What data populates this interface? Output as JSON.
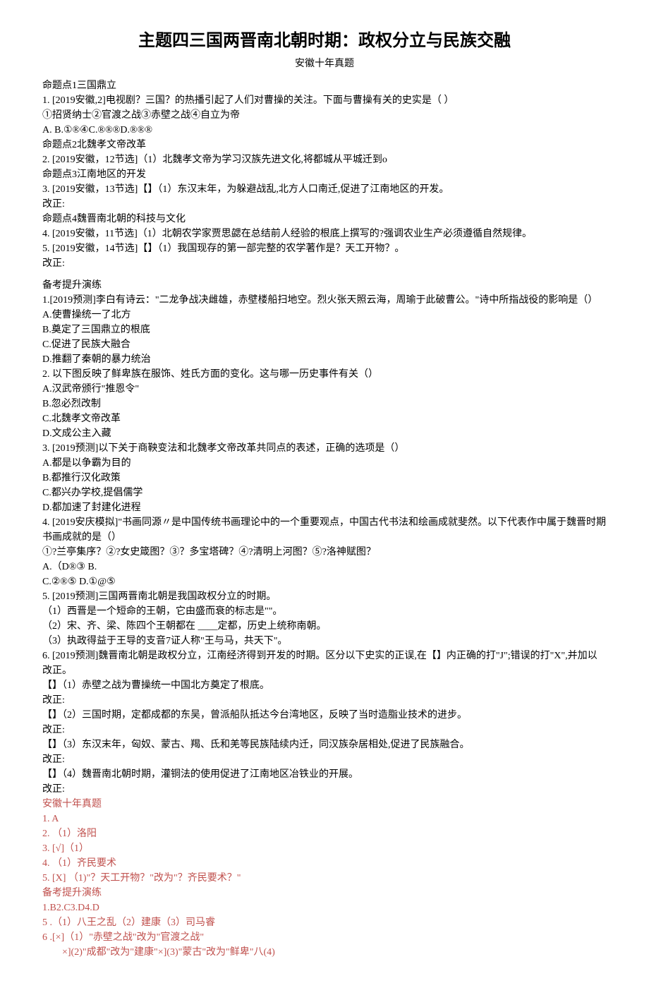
{
  "title": "主题四三国两晋南北朝时期：政权分立与民族交融",
  "subtitle": "安徽十年真题",
  "section1": {
    "cmd1": "命题点1三国鼎立",
    "q1l1": "1. [2019安徽,2]电视剧？三国？的热播引起了人们对曹操的关注。下面与曹操有关的史实是（   ）",
    "q1l2": "①招贤纳士②官渡之战③赤壁之战④自立为帝",
    "q1l3": "A.        B.①®④C.®®®D.®®®",
    "cmd2": "命题点2北魏孝文帝改革",
    "q2": "2. [2019安徽，12节选]（1）北魏孝文帝为学习汉族先进文化,将都城从平城迁到o",
    "cmd3": "命题点3江南地区的开发",
    "q3": "3. [2019安徽，13节选]【】（1）东汉末年，为躲避战乱,北方人口南迁,促进了江南地区的开发。",
    "q3fix": "改正:",
    "cmd4": "命题点4魏晋南北朝的科技与文化",
    "q4": "4.  [2019安徽，11节选]（1）北朝农学家贾思勰在总结前人经验的根底上撰写的?强调农业生产必须遵循自然规律。",
    "q5": "5. [2019安徽，14节选]【】（1）我国现存的第一部完整的农学著作是？天工开物？。",
    "q5fix": "改正:"
  },
  "section2": {
    "header": "备考提升演练",
    "q1l1": "1.[2019预测]李白有诗云：\"二龙争战决雌雄，赤壁楼船扫地空。烈火张天照云海，周瑜于此破曹公。\"诗中所指战役的影响是（）",
    "q1a": "A.使曹操统一了北方",
    "q1b": "B.奠定了三国鼎立的根底",
    "q1c": "C.促进了民族大融合",
    "q1d": "D.推翻了秦朝的暴力统治",
    "q2l1": "2. 以下图反映了鲜卑族在服饰、姓氏方面的变化。这与哪一历史事件有关（）",
    "q2a": "A.汉武帝颁行\"推恩令\"",
    "q2b": "B.忽必烈改制",
    "q2c": "C.北魏孝文帝改革",
    "q2d": "D.文成公主入藏",
    "q3l1": "3.  [2019预测]以下关于商鞅变法和北魏孝文帝改革共同点的表述，正确的选项是（）",
    "q3a": "A.都是以争霸为目的",
    "q3b": "B.都推行汉化政策",
    "q3c": "C.都兴办学校,提倡儒学",
    "q3d": "D.都加速了封建化进程",
    "q4l1": "4.  [2019安庆模拟]\"书画同源〃是中国传统书画理论中的一个重要观点，中国古代书法和绘画成就斐然。以下代表作中属于魏晋时期书画成就的是（）",
    "q4l2": "①?兰亭集序？②?女史箴图？③？多宝塔碑？④?清明上河图？⑤?洛神赋图？",
    "q4l3": "A.（D®③   B.",
    "q4l4": "C.②®⑤   D.①@⑤",
    "q5l1": "5. [2019预测]三国两晋南北朝是我国政权分立的时期。",
    "q5l2": "（1）西晋是一个短命的王朝，它由盛而衰的标志是\"\"。",
    "q5l3": "（2）宋、齐、梁、陈四个王朝都在 ____定都，历史上统称南朝。",
    "q5l4": "（3）执政得益于王导的支音7证人称\"王与马，共天下\"。",
    "q6l1": "6.  [2019预测]魏晋南北朝是政权分立，江南经济得到开发的时期。区分以下史实的正误,在【】内正确的打\"J\";错误的打\"X\",并加以改正。",
    "q6a": "  【】（1）赤壁之战为曹操统一中国北方奠定了根底。",
    "q6afix": "改正:",
    "q6b": "  【】（2）三国时期，定都成都的东吴，曾派船队抵达今台湾地区，反映了当时造脂业技术的进步。",
    "q6bfix": "改正:",
    "q6c": "  【】（3）东汉末年，匈奴、蒙古、羯、氐和羌等民族陆续内迁，同汉族杂居相处,促进了民族融合。",
    "q6cfix": "改正:",
    "q6d": "  【】（4）魏晋南北朝时期，灌铜法的使用促进了江南地区冶铁业的开展。",
    "q6dfix": "改正:"
  },
  "answers": {
    "h1": "安徽十年真题",
    "a1": "1. A",
    "a2": "2. （1）洛阳",
    "a3": "3. [√]（1）",
    "a4": "4. （1）齐民要术",
    "a5": "5. [X]   （1)\"？天工开物？\"改为\"？齐民要术？\"",
    "h2": "备考提升演练",
    "b1": "1.B2.C3.D4.D",
    "b5": "5 .（1）八王之乱（2）建康（3）司马睿",
    "b6l1": "6 .[×]（1）\"赤壁之战\"改为\"官渡之战\"",
    "b6l2": "×](2)\"成都\"改为\"建康\"×](3)\"蒙古\"改为\"鲜卑\"八(4)"
  }
}
